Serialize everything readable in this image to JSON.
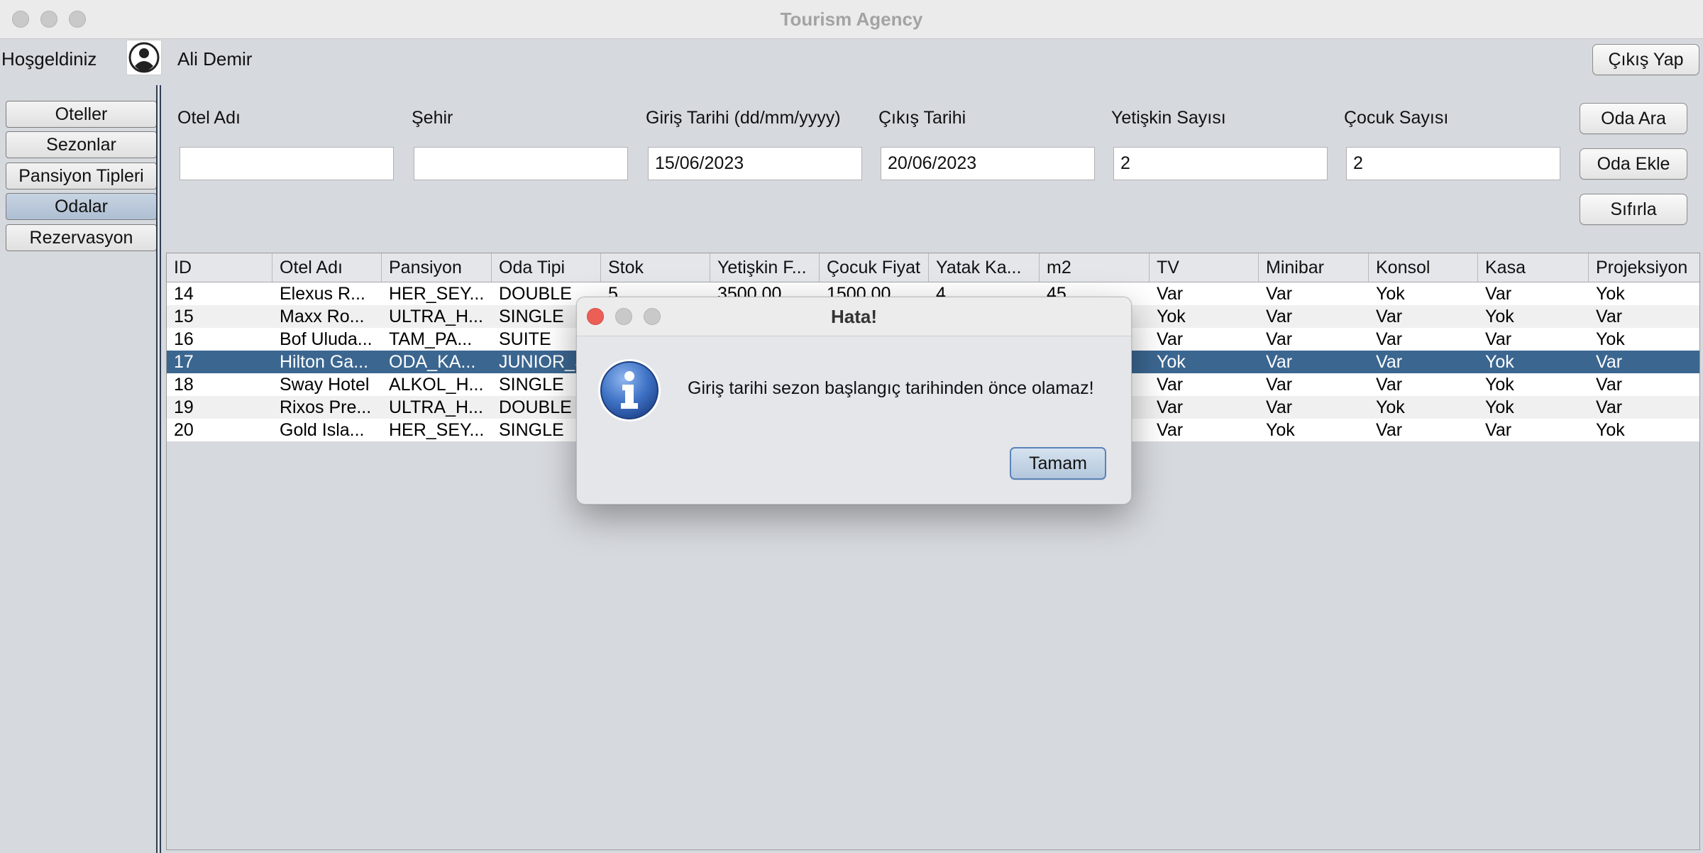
{
  "window": {
    "title": "Tourism Agency"
  },
  "header": {
    "welcome": "Hoşgeldiniz",
    "user_name": "Ali Demir",
    "logout_label": "Çıkış Yap"
  },
  "sidebar": {
    "items": [
      {
        "label": "Oteller"
      },
      {
        "label": "Sezonlar"
      },
      {
        "label": "Pansiyon Tipleri"
      },
      {
        "label": "Odalar",
        "active": true
      },
      {
        "label": "Rezervasyon"
      }
    ]
  },
  "filters": {
    "hotel_name": {
      "label": "Otel Adı",
      "value": ""
    },
    "city": {
      "label": "Şehir",
      "value": ""
    },
    "checkin": {
      "label": "Giriş Tarihi (dd/mm/yyyy)",
      "value": "15/06/2023"
    },
    "checkout": {
      "label": "Çıkış Tarihi",
      "value": "20/06/2023"
    },
    "adults": {
      "label": "Yetişkin Sayısı",
      "value": "2"
    },
    "children": {
      "label": "Çocuk Sayısı",
      "value": "2"
    }
  },
  "actions": {
    "search": "Oda Ara",
    "add": "Oda Ekle",
    "reset": "Sıfırla"
  },
  "table": {
    "columns": [
      "ID",
      "Otel Adı",
      "Pansiyon",
      "Oda Tipi",
      "Stok",
      "Yetişkin F...",
      "Çocuk Fiyat",
      "Yatak Ka...",
      "m2",
      "TV",
      "Minibar",
      "Konsol",
      "Kasa",
      "Projeksiyon"
    ],
    "selected_index": 3,
    "rows": [
      [
        "14",
        "Elexus R...",
        "HER_SEY...",
        "DOUBLE",
        "5",
        "3500.00",
        "1500.00",
        "4",
        "45",
        "Var",
        "Var",
        "Yok",
        "Var",
        "Yok"
      ],
      [
        "15",
        "Maxx Ro...",
        "ULTRA_H...",
        "SINGLE",
        "",
        "",
        "",
        "",
        "",
        "Yok",
        "Var",
        "Var",
        "Yok",
        "Var"
      ],
      [
        "16",
        "Bof Uluda...",
        "TAM_PA...",
        "SUITE",
        "",
        "",
        "",
        "",
        "",
        "Var",
        "Var",
        "Var",
        "Var",
        "Yok"
      ],
      [
        "17",
        "Hilton Ga...",
        "ODA_KA...",
        "JUNIOR_S",
        "",
        "",
        "",
        "",
        "",
        "Yok",
        "Var",
        "Var",
        "Yok",
        "Var"
      ],
      [
        "18",
        "Sway Hotel",
        "ALKOL_H...",
        "SINGLE",
        "",
        "",
        "",
        "",
        "",
        "Var",
        "Var",
        "Var",
        "Yok",
        "Var"
      ],
      [
        "19",
        "Rixos Pre...",
        "ULTRA_H...",
        "DOUBLE",
        "",
        "",
        "",
        "",
        "",
        "Var",
        "Var",
        "Yok",
        "Yok",
        "Var"
      ],
      [
        "20",
        "Gold Isla...",
        "HER_SEY...",
        "SINGLE",
        "",
        "",
        "",
        "",
        "",
        "Var",
        "Yok",
        "Var",
        "Var",
        "Yok"
      ]
    ]
  },
  "dialog": {
    "title": "Hata!",
    "message": "Giriş tarihi sezon başlangıç tarihinden önce olamaz!",
    "ok_label": "Tamam",
    "icon": "info-icon"
  },
  "colors": {
    "selection": "#3b6690",
    "dialog_button": "#c3d2e2",
    "close_dot": "#ec5f57"
  }
}
